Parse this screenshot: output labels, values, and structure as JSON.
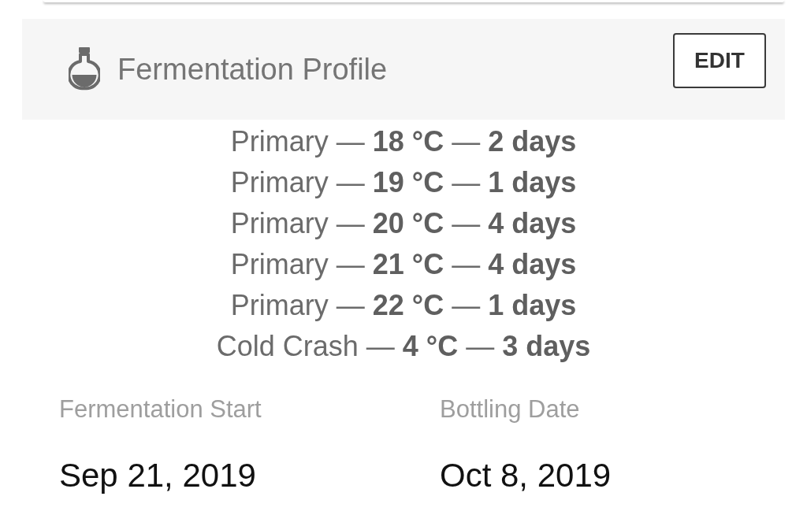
{
  "section": {
    "title": "Fermentation Profile",
    "action": "EDIT"
  },
  "steps": [
    "Primary — **18 °C** — **2 days**",
    "Primary — **19 °C** — **1 days**",
    "Primary — **20 °C** — **4 days**",
    "Primary — **21 °C** — **4 days**",
    "Primary — **22 °C** — **1 days**",
    "Cold Crash — **4 °C** — **3 days**"
  ],
  "dates": [
    {
      "label": "Fermentation Start",
      "value": "Sep 21, 2019"
    },
    {
      "label": "Bottling Date",
      "value": "Oct 8, 2019"
    }
  ]
}
